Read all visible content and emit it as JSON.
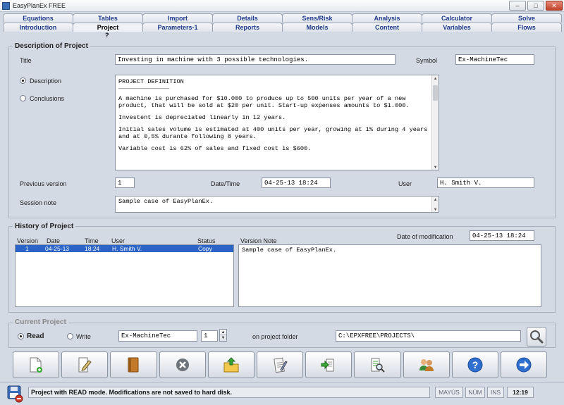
{
  "window": {
    "title": "EasyPlanEx FREE"
  },
  "tabs": {
    "row1": [
      "Equations",
      "Tables",
      "Import",
      "Details",
      "Sens/Risk",
      "Analysis",
      "Calculator",
      "Solve"
    ],
    "row2": [
      "Introduction",
      "Project",
      "Parameters-1",
      "Reports",
      "Models",
      "Content",
      "Variables",
      "Flows"
    ],
    "active": "Project",
    "help_mark": "?"
  },
  "description_panel": {
    "legend": "Description of Project",
    "title_label": "Title",
    "title_value": "Investing in machine with 3 possible technologies.",
    "symbol_label": "Symbol",
    "symbol_value": "Ex-MachineTec",
    "radio_description": "Description",
    "radio_conclusions": "Conclusions",
    "selected_radio": "Description",
    "text": {
      "heading": "PROJECT DEFINITION",
      "rule": "——————————————",
      "p1": "A machine is purchased for $10.000 to produce up to 500 units per year of a new product, that will be sold at $20 per unit. Start-up expenses amounts to $1.000.",
      "p2": "Investent is depreciated linearly in 12 years.",
      "p3": "Initial sales volume is estimated at 400 units per year, growing at 1% during 4 years and at 0,5% durante following 8 years.",
      "p4": "Variable cost is 62% of sales and fixed cost is $600."
    },
    "previous_version_label": "Previous version",
    "previous_version_value": "1",
    "datetime_label": "Date/Time",
    "datetime_value": "04-25-13  18:24",
    "user_label": "User",
    "user_value": "H. Smith V.",
    "session_note_label": "Session note",
    "session_note_value": "Sample case of EasyPlanEx."
  },
  "history_panel": {
    "legend": "History of Project",
    "date_mod_label": "Date of modification",
    "date_mod_value": "04-25-13  18:24",
    "columns": [
      "Version",
      "Date",
      "Time",
      "User",
      "Status"
    ],
    "version_note_label": "Version Note",
    "rows": [
      {
        "version": "1",
        "date": "04-25-13",
        "time": "18:24",
        "user": "H. Smith V.",
        "status": "Copy"
      }
    ],
    "version_note_value": "Sample case of EasyPlanEx."
  },
  "current_panel": {
    "legend": "Current Project",
    "read_label": "Read",
    "write_label": "Write",
    "mode": "Read",
    "project_value": "Ex-MachineTec",
    "version_value": "1",
    "folder_label": "on project folder",
    "folder_value": "C:\\EPXFREE\\PROJECTS\\"
  },
  "toolbar": {
    "buttons": [
      "new-document-icon",
      "edit-icon",
      "book-icon",
      "delete-icon",
      "upload-folder-icon",
      "notes-icon",
      "copy-file-icon",
      "search-file-icon",
      "users-icon",
      "help-icon",
      "next-arrow-icon"
    ]
  },
  "statusbar": {
    "message": "Project with READ mode. Modifications are not saved to hard disk.",
    "caps": "MAYÚS",
    "num": "NÚM",
    "ins": "INS",
    "time": "12:19"
  },
  "colors": {
    "background": "#d4dae3",
    "tab_text": "#203a8c",
    "selection": "#2b64c6",
    "close": "#c0422b"
  }
}
